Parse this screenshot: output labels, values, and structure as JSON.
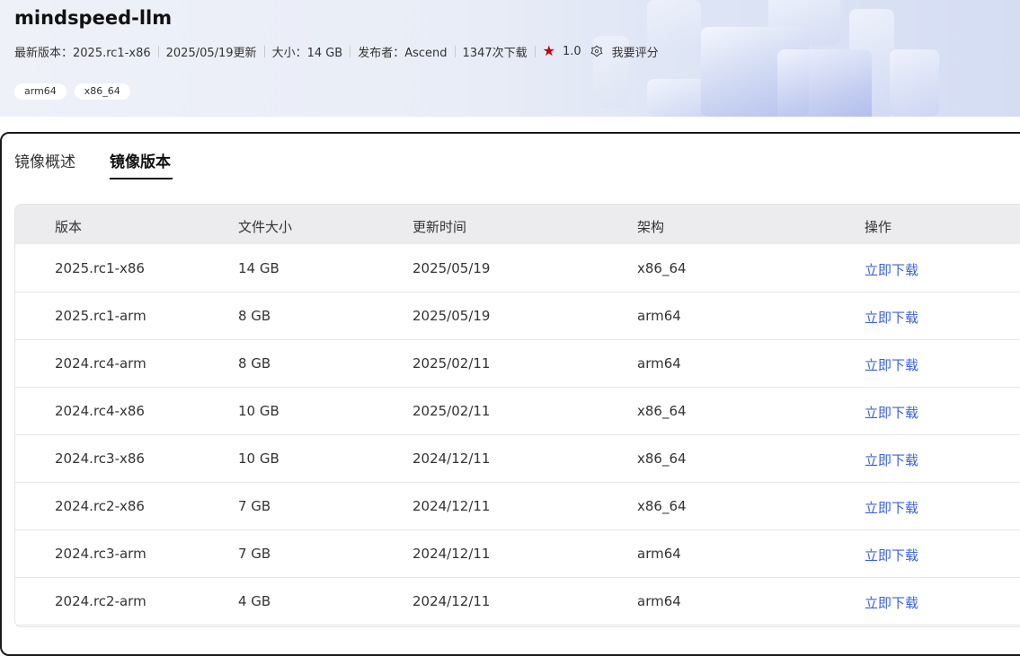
{
  "header": {
    "title": "mindspeed-llm",
    "meta": {
      "latest_version": "最新版本：2025.rc1-x86",
      "updated": "2025/05/19更新",
      "size": "大小：14 GB",
      "publisher": "发布者：Ascend",
      "downloads": "1347次下载",
      "rating": "1.0",
      "rate_label": "我要评分"
    },
    "tags": [
      "arm64",
      "x86_64"
    ]
  },
  "tabs": [
    {
      "label": "镜像概述",
      "active": false
    },
    {
      "label": "镜像版本",
      "active": true
    }
  ],
  "table": {
    "columns": [
      "版本",
      "文件大小",
      "更新时间",
      "架构",
      "操作"
    ],
    "rows": [
      {
        "version": "2025.rc1-x86",
        "size": "14 GB",
        "date": "2025/05/19",
        "arch": "x86_64",
        "action": "立即下载"
      },
      {
        "version": "2025.rc1-arm",
        "size": "8 GB",
        "date": "2025/05/19",
        "arch": "arm64",
        "action": "立即下载"
      },
      {
        "version": "2024.rc4-arm",
        "size": "8 GB",
        "date": "2025/02/11",
        "arch": "arm64",
        "action": "立即下载"
      },
      {
        "version": "2024.rc4-x86",
        "size": "10 GB",
        "date": "2025/02/11",
        "arch": "x86_64",
        "action": "立即下载"
      },
      {
        "version": "2024.rc3-x86",
        "size": "10 GB",
        "date": "2024/12/11",
        "arch": "x86_64",
        "action": "立即下载"
      },
      {
        "version": "2024.rc2-x86",
        "size": "7 GB",
        "date": "2024/12/11",
        "arch": "x86_64",
        "action": "立即下载"
      },
      {
        "version": "2024.rc3-arm",
        "size": "7 GB",
        "date": "2024/12/11",
        "arch": "arm64",
        "action": "立即下载"
      },
      {
        "version": "2024.rc2-arm",
        "size": "4 GB",
        "date": "2024/12/11",
        "arch": "arm64",
        "action": "立即下载"
      }
    ]
  },
  "colors": {
    "accent_link": "#3b62d8",
    "star": "#c7000b",
    "header_bg": "#e9edf7",
    "table_head_bg": "#ececef"
  },
  "icons": {
    "star": "star-icon",
    "rate": "rate-icon"
  }
}
